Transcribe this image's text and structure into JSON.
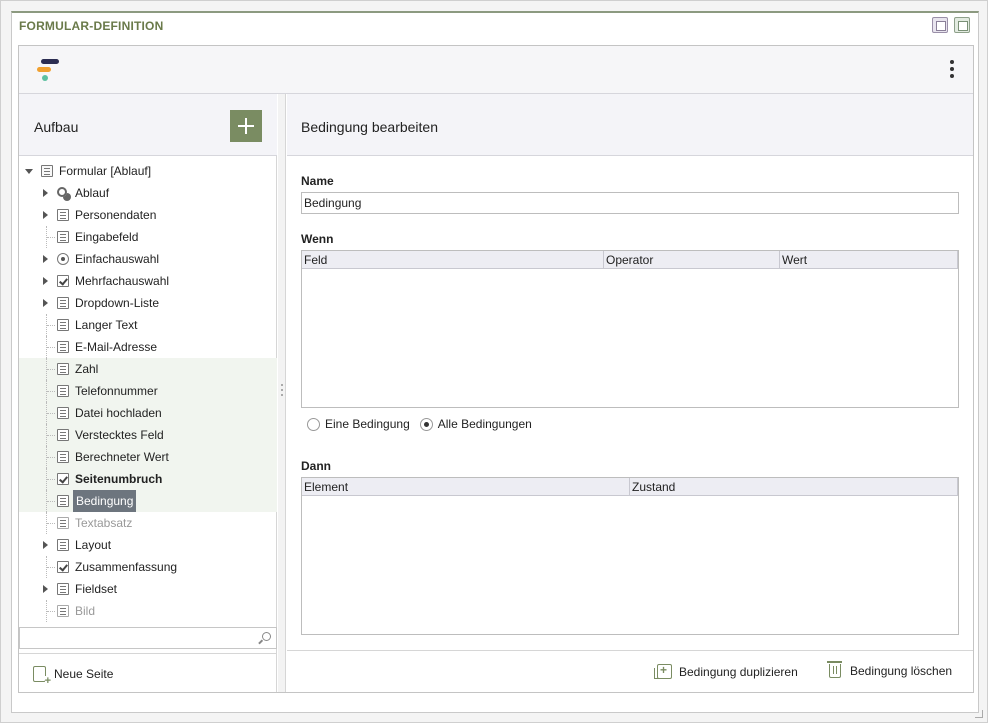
{
  "panel": {
    "title": "FORMULAR-DEFINITION"
  },
  "left": {
    "heading": "Aufbau",
    "tree": {
      "root": "Formular [Ablauf]",
      "items": [
        {
          "label": "Ablauf",
          "icon": "gear-icon",
          "expandable": true
        },
        {
          "label": "Personendaten",
          "icon": "list-icon",
          "expandable": true
        },
        {
          "label": "Eingabefeld",
          "icon": "textfield-icon",
          "expandable": false
        },
        {
          "label": "Einfachauswahl",
          "icon": "radio-icon",
          "expandable": true
        },
        {
          "label": "Mehrfachauswahl",
          "icon": "checkbox-icon",
          "expandable": true
        },
        {
          "label": "Dropdown-Liste",
          "icon": "dropdown-icon",
          "expandable": true
        },
        {
          "label": "Langer Text",
          "icon": "textarea-icon",
          "expandable": false
        },
        {
          "label": "E-Mail-Adresse",
          "icon": "email-icon",
          "expandable": false
        },
        {
          "label": "Zahl",
          "icon": "number-icon",
          "expandable": false
        },
        {
          "label": "Telefonnummer",
          "icon": "phone-icon",
          "expandable": false
        },
        {
          "label": "Datei hochladen",
          "icon": "upload-icon",
          "expandable": false
        },
        {
          "label": "Verstecktes Feld",
          "icon": "hidden-field-icon",
          "expandable": false
        },
        {
          "label": "Berechneter Wert",
          "icon": "calculator-icon",
          "expandable": false
        },
        {
          "label": "Seitenumbruch",
          "icon": "pagebreak-icon",
          "expandable": false,
          "bold": true
        },
        {
          "label": "Bedingung",
          "icon": "condition-icon",
          "expandable": false,
          "selected": true
        },
        {
          "label": "Textabsatz",
          "icon": "paragraph-icon",
          "expandable": false,
          "muted": true
        },
        {
          "label": "Layout",
          "icon": "layout-icon",
          "expandable": true
        },
        {
          "label": "Zusammenfassung",
          "icon": "summary-icon",
          "expandable": false
        },
        {
          "label": "Fieldset",
          "icon": "fieldset-icon",
          "expandable": true
        },
        {
          "label": "Bild",
          "icon": "image-icon",
          "expandable": false,
          "muted": true
        }
      ]
    },
    "search": {
      "value": "",
      "placeholder": ""
    },
    "new_page_label": "Neue Seite"
  },
  "right": {
    "heading": "Bedingung bearbeiten",
    "name_label": "Name",
    "name_value": "Bedingung",
    "wenn_label": "Wenn",
    "wenn_columns": [
      "Feld",
      "Operator",
      "Wert"
    ],
    "radio_options": [
      {
        "label": "Eine Bedingung",
        "checked": false
      },
      {
        "label": "Alle Bedingungen",
        "checked": true
      }
    ],
    "dann_label": "Dann",
    "dann_columns": [
      "Element",
      "Zustand"
    ],
    "duplicate_label": "Bedingung duplizieren",
    "delete_label": "Bedingung löschen"
  },
  "colors": {
    "accent": "#7a8c62",
    "selected_bg": "#6d757e",
    "title": "#6a7a4a"
  }
}
